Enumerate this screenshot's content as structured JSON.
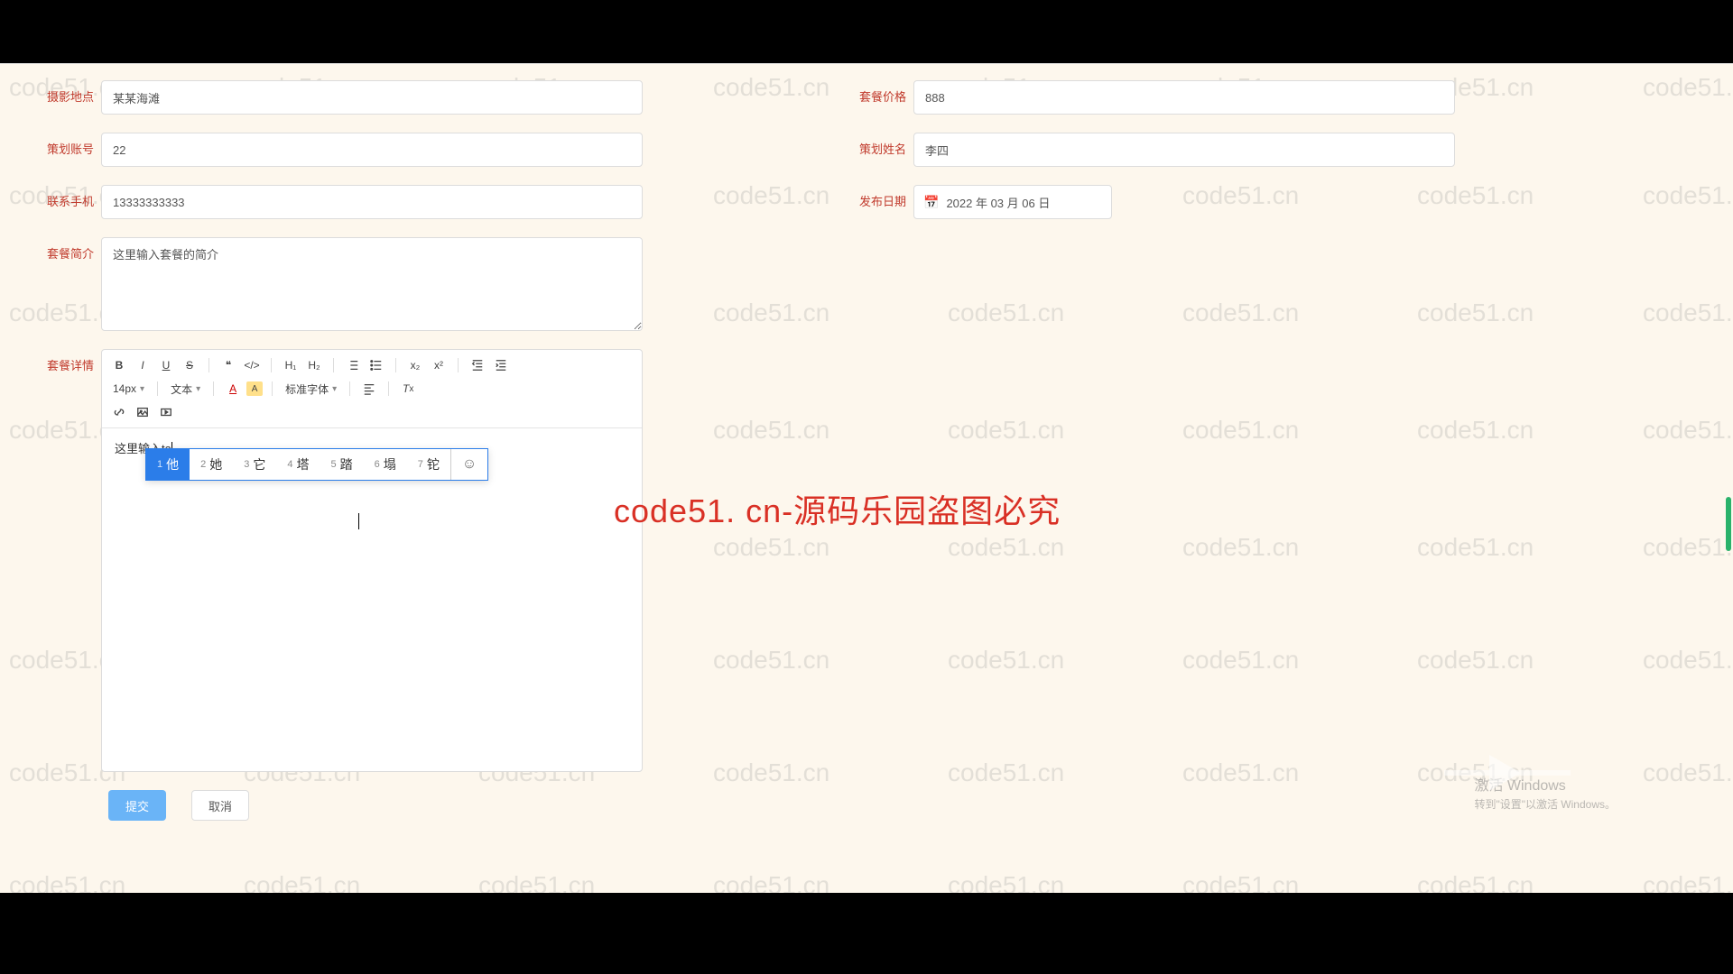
{
  "watermark_text": "code51.cn",
  "overlay_text": "code51. cn-源码乐园盗图必究",
  "activate": {
    "title": "激活 Windows",
    "sub": "转到\"设置\"以激活 Windows。"
  },
  "form": {
    "location": {
      "label": "摄影地点",
      "value": "某某海滩"
    },
    "price": {
      "label": "套餐价格",
      "value": "888"
    },
    "planner_account": {
      "label": "策划账号",
      "value": "22"
    },
    "planner_name": {
      "label": "策划姓名",
      "value": "李四"
    },
    "phone": {
      "label": "联系手机",
      "value": "13333333333"
    },
    "publish_date": {
      "label": "发布日期",
      "value": "2022 年 03 月 06 日"
    },
    "summary": {
      "label": "套餐简介",
      "value": "这里输入套餐的简介"
    },
    "detail": {
      "label": "套餐详情",
      "value": "这里输入ta"
    }
  },
  "editor_toolbar": {
    "font_size": "14px",
    "text_type": "文本",
    "font_family": "标准字体"
  },
  "ime": {
    "candidates": [
      {
        "num": "1",
        "char": "他"
      },
      {
        "num": "2",
        "char": "她"
      },
      {
        "num": "3",
        "char": "它"
      },
      {
        "num": "4",
        "char": "塔"
      },
      {
        "num": "5",
        "char": "踏"
      },
      {
        "num": "6",
        "char": "塌"
      },
      {
        "num": "7",
        "char": "铊"
      }
    ]
  },
  "buttons": {
    "submit": "提交",
    "cancel": "取消"
  }
}
